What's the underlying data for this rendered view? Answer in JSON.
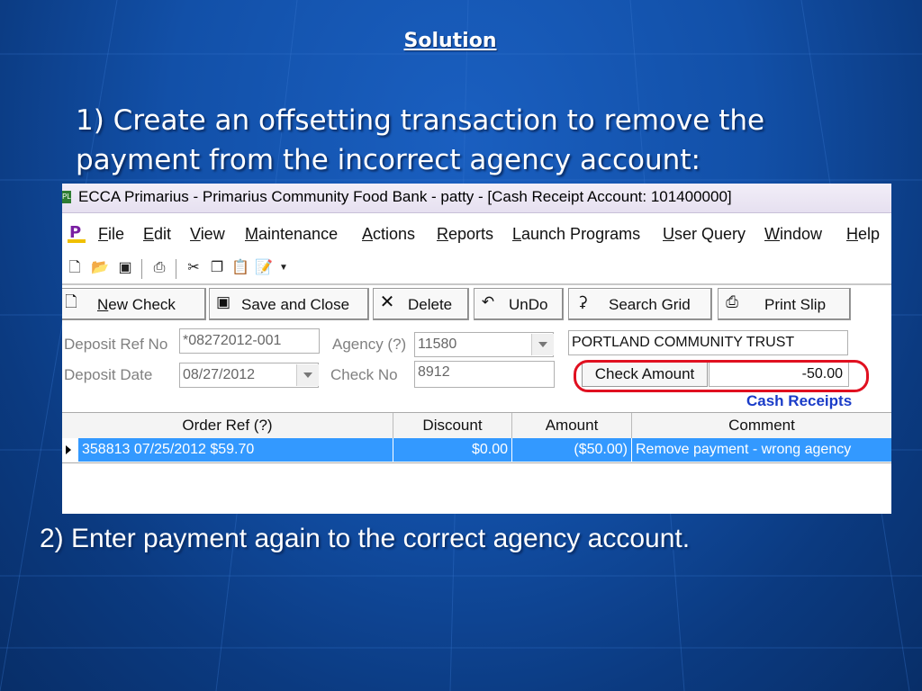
{
  "slide": {
    "title": "Solution",
    "step1": "1) Create an offsetting transaction to remove the payment from the incorrect agency account:",
    "step2": "2) Enter payment again to the correct agency account."
  },
  "window": {
    "title": "ECCA Primarius - Primarius Community Food Bank - patty - [Cash Receipt Account: 101400000]",
    "app_icon_text": "PL"
  },
  "menu": {
    "items": [
      {
        "u": "F",
        "rest": "ile"
      },
      {
        "u": "E",
        "rest": "dit"
      },
      {
        "u": "V",
        "rest": "iew"
      },
      {
        "u": "M",
        "rest": "aintenance"
      },
      {
        "u": "A",
        "rest": "ctions"
      },
      {
        "u": "R",
        "rest": "eports"
      },
      {
        "u": "L",
        "rest": "aunch Programs"
      },
      {
        "u": "U",
        "rest": "ser Query"
      },
      {
        "u": "W",
        "rest": "indow"
      },
      {
        "u": "H",
        "rest": "elp"
      }
    ]
  },
  "toolbar": {
    "icons": [
      "new-file-icon",
      "open-folder-icon",
      "save-icon",
      "print-icon",
      "cut-icon",
      "copy-icon",
      "paste-icon",
      "paste-special-icon"
    ]
  },
  "buttons": {
    "new_check": {
      "u": "N",
      "rest": "ew Check"
    },
    "save_close": "Save and Close",
    "delete": "Delete",
    "undo": "UnDo",
    "search_grid": "Search Grid",
    "print_slip": "Print Slip"
  },
  "form": {
    "deposit_ref_label": "Deposit Ref No",
    "deposit_ref_value": "*08272012-001",
    "agency_label": "Agency (?)",
    "agency_value": "11580",
    "agency_name": "PORTLAND COMMUNITY TRUST",
    "deposit_date_label": "Deposit Date",
    "deposit_date_value": "08/27/2012",
    "check_no_label": "Check No",
    "check_no_value": "8912",
    "check_amount_label": "Check Amount",
    "check_amount_value": "-50.00",
    "section_label": "Cash Receipts"
  },
  "grid": {
    "headers": [
      "Order Ref (?)",
      "Discount",
      "Amount",
      "Comment"
    ],
    "rows": [
      {
        "order_ref": "358813  07/25/2012  $59.70",
        "discount": "$0.00",
        "amount": "($50.00)",
        "comment": "Remove payment - wrong agency"
      }
    ]
  },
  "colors": {
    "background": "#1250a8",
    "selected_row": "#3399ff",
    "highlight_oval": "#e01020",
    "section_label": "#1a3cc8"
  }
}
